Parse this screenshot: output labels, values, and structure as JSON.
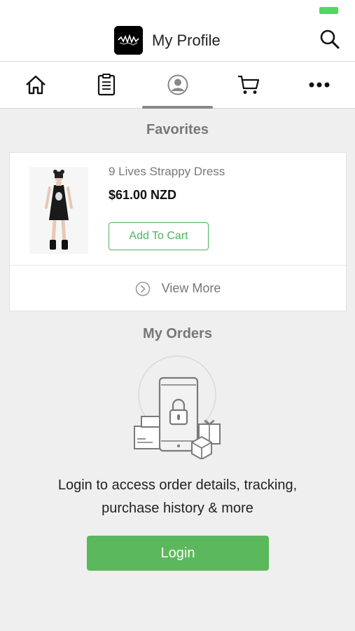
{
  "header": {
    "title": "My Profile",
    "logo_icon": "brand-logo-icon",
    "search_icon": "search-icon"
  },
  "tabs": [
    {
      "icon": "home-icon",
      "active": false
    },
    {
      "icon": "clipboard-icon",
      "active": false
    },
    {
      "icon": "user-icon",
      "active": true
    },
    {
      "icon": "cart-icon",
      "active": false
    },
    {
      "icon": "more-icon",
      "active": false
    }
  ],
  "favorites": {
    "title": "Favorites",
    "item": {
      "name": "9 Lives Strappy Dress",
      "price": "$61.00 NZD",
      "add_to_cart_label": "Add To Cart"
    },
    "view_more_label": "View More"
  },
  "orders": {
    "title": "My Orders",
    "message_line1": "Login to access order details, tracking,",
    "message_line2": "purchase history & more",
    "login_label": "Login"
  },
  "colors": {
    "accent_green": "#5cb85c",
    "battery_green": "#4cd964",
    "muted_text": "#777777"
  }
}
